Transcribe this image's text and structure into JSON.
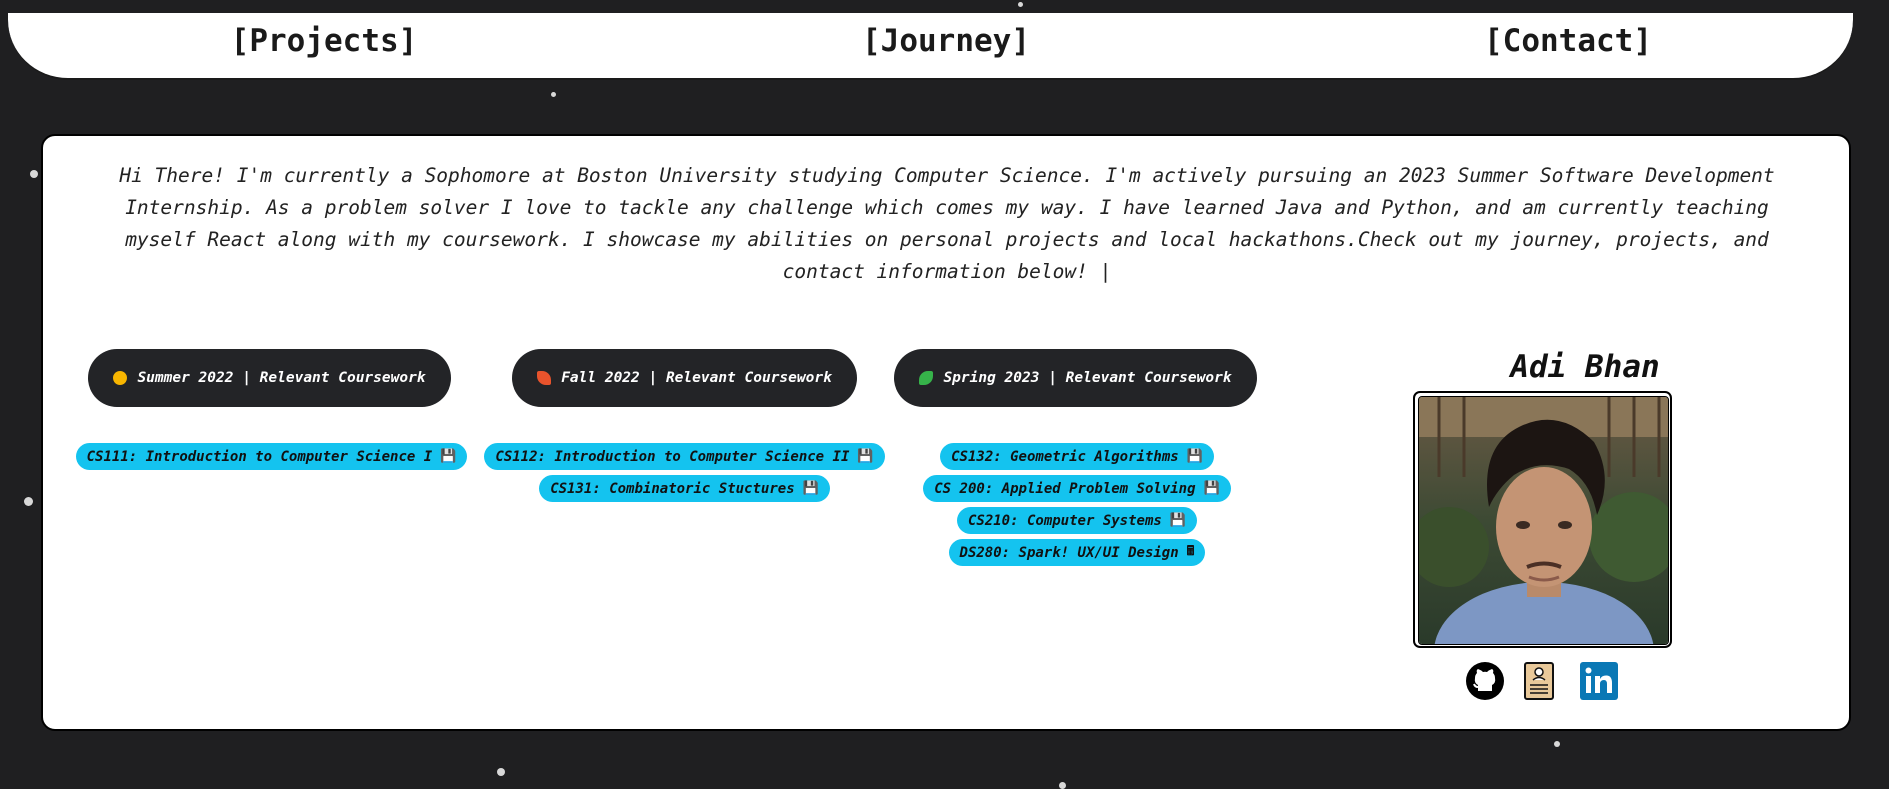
{
  "nav": {
    "projects": "[Projects]",
    "journey": "[Journey]",
    "contact": "[Contact]"
  },
  "intro": {
    "text": "Hi There! I'm currently a Sophomore at Boston University studying Computer Science. I'm actively pursuing an 2023 Summer Software Development Internship. As a problem solver I love to tackle any challenge which comes my way. I have learned Java and Python, and am currently teaching myself React along with my coursework. I showcase my abilities on personal projects and local hackathons.Check out my journey, projects, and contact information below!",
    "cursor": "|"
  },
  "terms": [
    {
      "label": "Summer 2022 | Relevant Coursework",
      "icon": "sun-icon",
      "icon_color": "#f7b500",
      "courses": [
        {
          "label": "CS111: Introduction to Computer Science I",
          "icon": "floppy-disk-icon"
        }
      ]
    },
    {
      "label": "Fall 2022 | Relevant Coursework",
      "icon": "autumn-leaf-icon",
      "icon_color": "#e8532c",
      "courses": [
        {
          "label": "CS112: Introduction to Computer Science II",
          "icon": "floppy-disk-icon"
        },
        {
          "label": "CS131: Combinatoric Stuctures",
          "icon": "floppy-disk-icon"
        }
      ]
    },
    {
      "label": "Spring 2023 | Relevant Coursework",
      "icon": "sprout-leaf-icon",
      "icon_color": "#36b34a",
      "courses": [
        {
          "label": "CS132: Geometric Algorithms",
          "icon": "floppy-disk-icon"
        },
        {
          "label": "CS 200: Applied Problem Solving",
          "icon": "floppy-disk-icon"
        },
        {
          "label": "CS210: Computer Systems",
          "icon": "floppy-disk-icon"
        },
        {
          "label": "DS280: Spark! UX/UI Design",
          "icon": "calculator-icon"
        }
      ]
    }
  ],
  "profile": {
    "name": "Adi Bhan"
  },
  "social": {
    "github_icon": "github-icon",
    "resume_icon": "resume-icon",
    "linkedin_icon": "linkedin-icon",
    "linkedin_color": "#0a78b5"
  },
  "colors": {
    "page_bg": "#1f1f21",
    "pill_bg": "#232427",
    "course_bg": "#14c3ef"
  }
}
